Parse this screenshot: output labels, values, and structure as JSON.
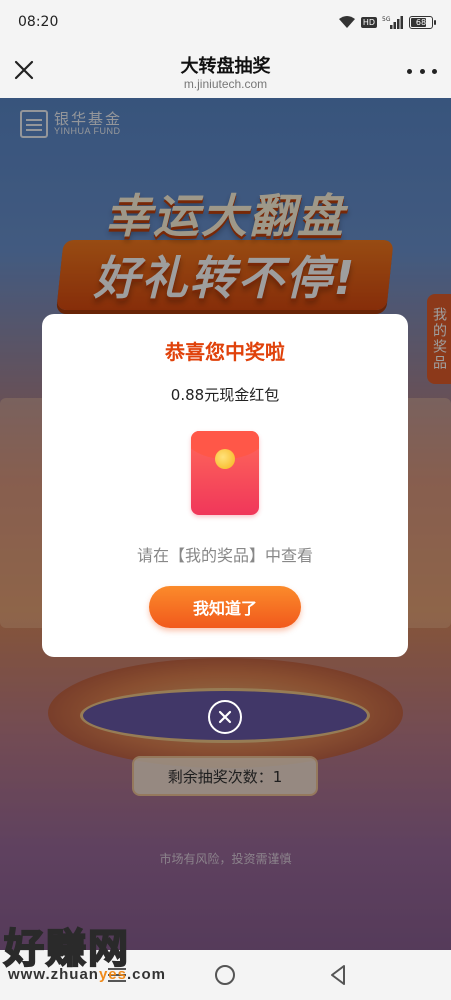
{
  "status_bar": {
    "time": "08:20",
    "network_badge": "HD",
    "network_type": "5G",
    "battery": "68"
  },
  "title_bar": {
    "title": "大转盘抽奖",
    "url": "m.jiniutech.com"
  },
  "page": {
    "logo_cn": "银华基金",
    "logo_en": "YINHUA FUND",
    "banner_line1": "幸运大翻盘",
    "banner_line2": "好礼转不停!",
    "my_prizes_tab": "我的奖品",
    "remaining_draws": "剩余抽奖次数：1",
    "risk_note": "市场有风险，投资需谨慎"
  },
  "modal": {
    "title": "恭喜您中奖啦",
    "prize": "0.88元现金红包",
    "hint": "请在【我的奖品】中查看",
    "ok_label": "我知道了"
  },
  "watermark": {
    "main": "好赚网",
    "url_prefix": "www.zhuan",
    "url_highlight": "yes",
    "url_suffix": ".com"
  },
  "colors": {
    "accent": "#f1591c",
    "title_red": "#e0420b"
  },
  "icons": [
    "wifi-icon",
    "signal-icon",
    "battery-icon",
    "close-icon",
    "more-icon",
    "red-envelope-icon",
    "close-circle-icon",
    "menu-icon",
    "home-icon",
    "back-icon"
  ]
}
